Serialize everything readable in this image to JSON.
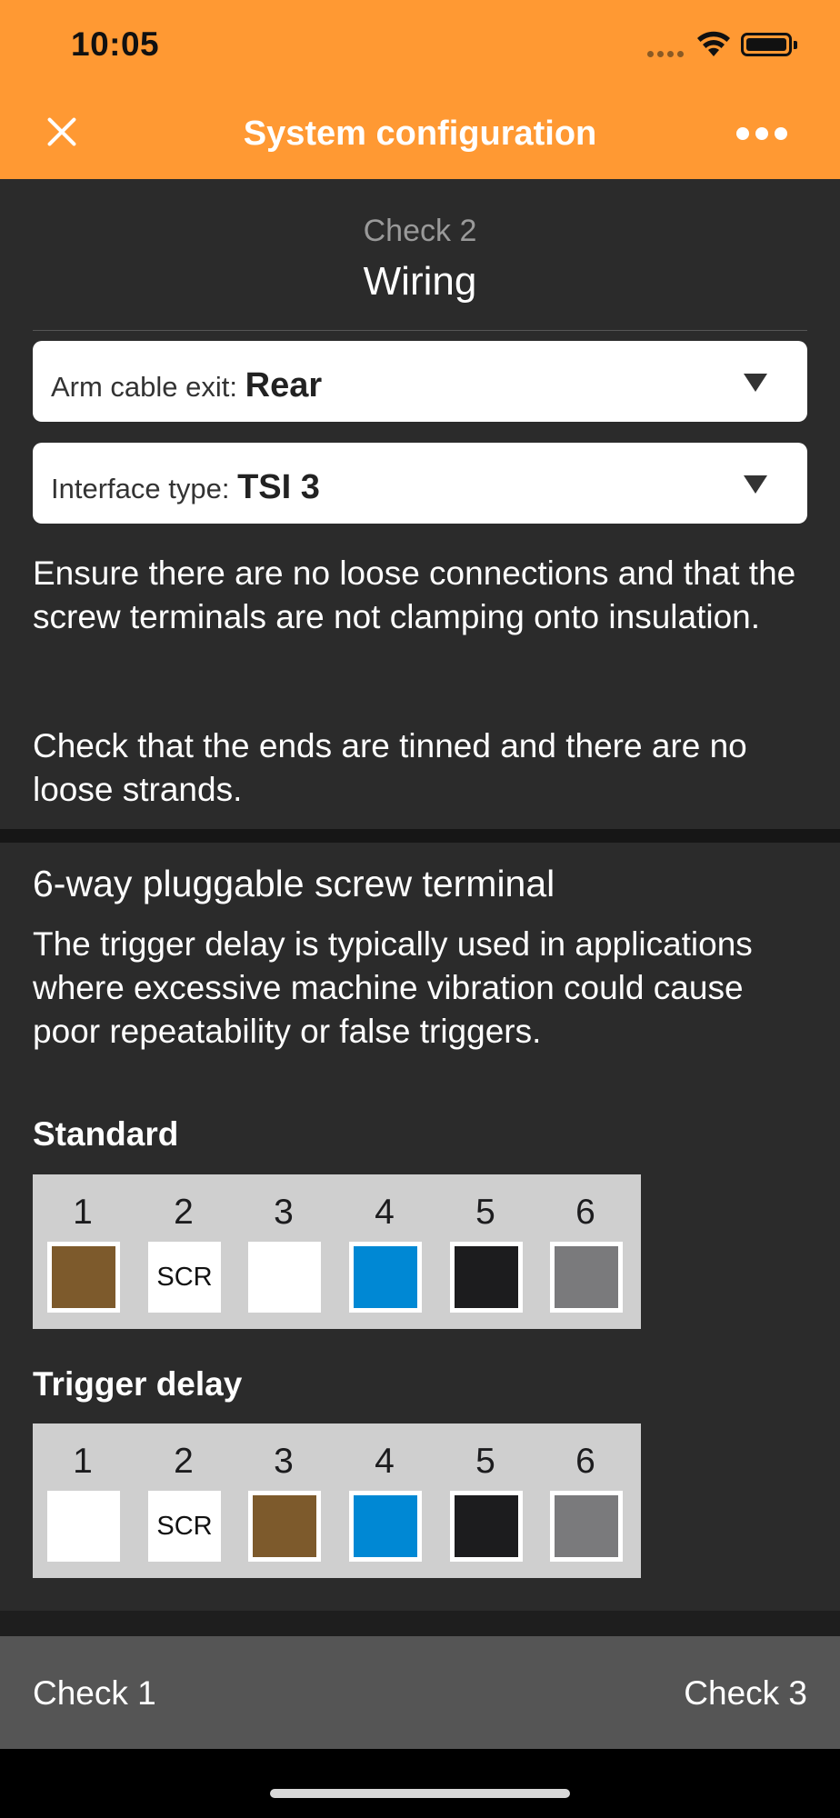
{
  "status_bar": {
    "time": "10:05"
  },
  "nav": {
    "title": "System configuration",
    "close_icon": "close-icon",
    "more_icon": "more-icon"
  },
  "check": {
    "number": "Check 2",
    "name": "Wiring"
  },
  "selects": [
    {
      "label": "Arm cable exit:",
      "value": "Rear"
    },
    {
      "label": "Interface type:",
      "value": "TSI 3"
    }
  ],
  "instructions": [
    "Ensure there are no loose connections and that the screw terminals are not clamping onto insulation.",
    "Check that the ends are tinned and there are no loose strands."
  ],
  "terminal_section": {
    "title": "6-way pluggable screw terminal",
    "description": "The trigger delay is typically used in applications where excessive machine vibration could cause poor repeatability or false triggers.",
    "standard": {
      "title": "Standard",
      "pins": [
        {
          "num": "1",
          "color": "#7d5a2c",
          "text": ""
        },
        {
          "num": "2",
          "color": "#ffffff",
          "text": "SCR"
        },
        {
          "num": "3",
          "color": "#ffffff",
          "text": ""
        },
        {
          "num": "4",
          "color": "#0088d4",
          "text": ""
        },
        {
          "num": "5",
          "color": "#1c1c1e",
          "text": ""
        },
        {
          "num": "6",
          "color": "#7a7a7c",
          "text": ""
        }
      ]
    },
    "trigger_delay": {
      "title": "Trigger delay",
      "pins": [
        {
          "num": "1",
          "color": "#ffffff",
          "text": ""
        },
        {
          "num": "2",
          "color": "#ffffff",
          "text": "SCR"
        },
        {
          "num": "3",
          "color": "#7d5a2c",
          "text": ""
        },
        {
          "num": "4",
          "color": "#0088d4",
          "text": ""
        },
        {
          "num": "5",
          "color": "#1c1c1e",
          "text": ""
        },
        {
          "num": "6",
          "color": "#7a7a7c",
          "text": ""
        }
      ]
    }
  },
  "footer": {
    "prev": "Check 1",
    "next": "Check 3"
  },
  "colors": {
    "header": "#ff9933",
    "background": "#2b2b2b",
    "footer": "#555555"
  }
}
